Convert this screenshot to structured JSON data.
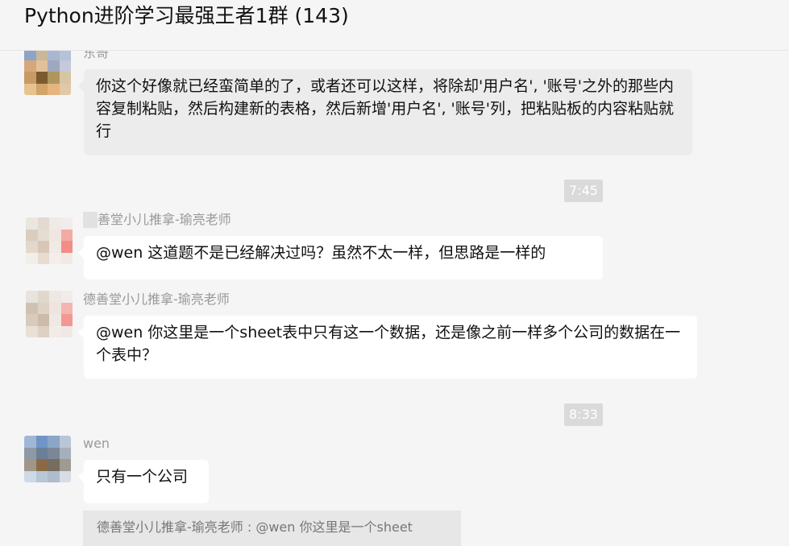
{
  "chat": {
    "title": "Python进阶学习最强王者1群 (143)"
  },
  "messages": [
    {
      "sender": "东哥",
      "text": "你这个好像就已经蛮简单的了，或者还可以这样，将除却'用户名', '账号'之外的那些内容复制粘贴，然后构建新的表格，然后新增'用户名', '账号'列，把粘贴板的内容粘贴就行"
    },
    {
      "time": "7:45"
    },
    {
      "sender": "善堂小儿推拿-瑜亮老师",
      "text": "@wen 这道题不是已经解决过吗？虽然不太一样，但思路是一样的"
    },
    {
      "sender": "德善堂小儿推拿-瑜亮老师",
      "text": "@wen 你这里是一个sheet表中只有这一个数据，还是像之前一样多个公司的数据在一个表中？"
    },
    {
      "time": "8:33"
    },
    {
      "sender": "wen",
      "text": "只有一个公司"
    }
  ],
  "quote": {
    "text": "德善堂小儿推拿-瑜亮老师 : @wen 你这里是一个sheet"
  },
  "colors": {
    "background": "#f5f5f5",
    "bubble": "#ffffff",
    "bubble_highlight": "#ececec",
    "time_badge": "#dadada",
    "sender_text": "#999999"
  }
}
